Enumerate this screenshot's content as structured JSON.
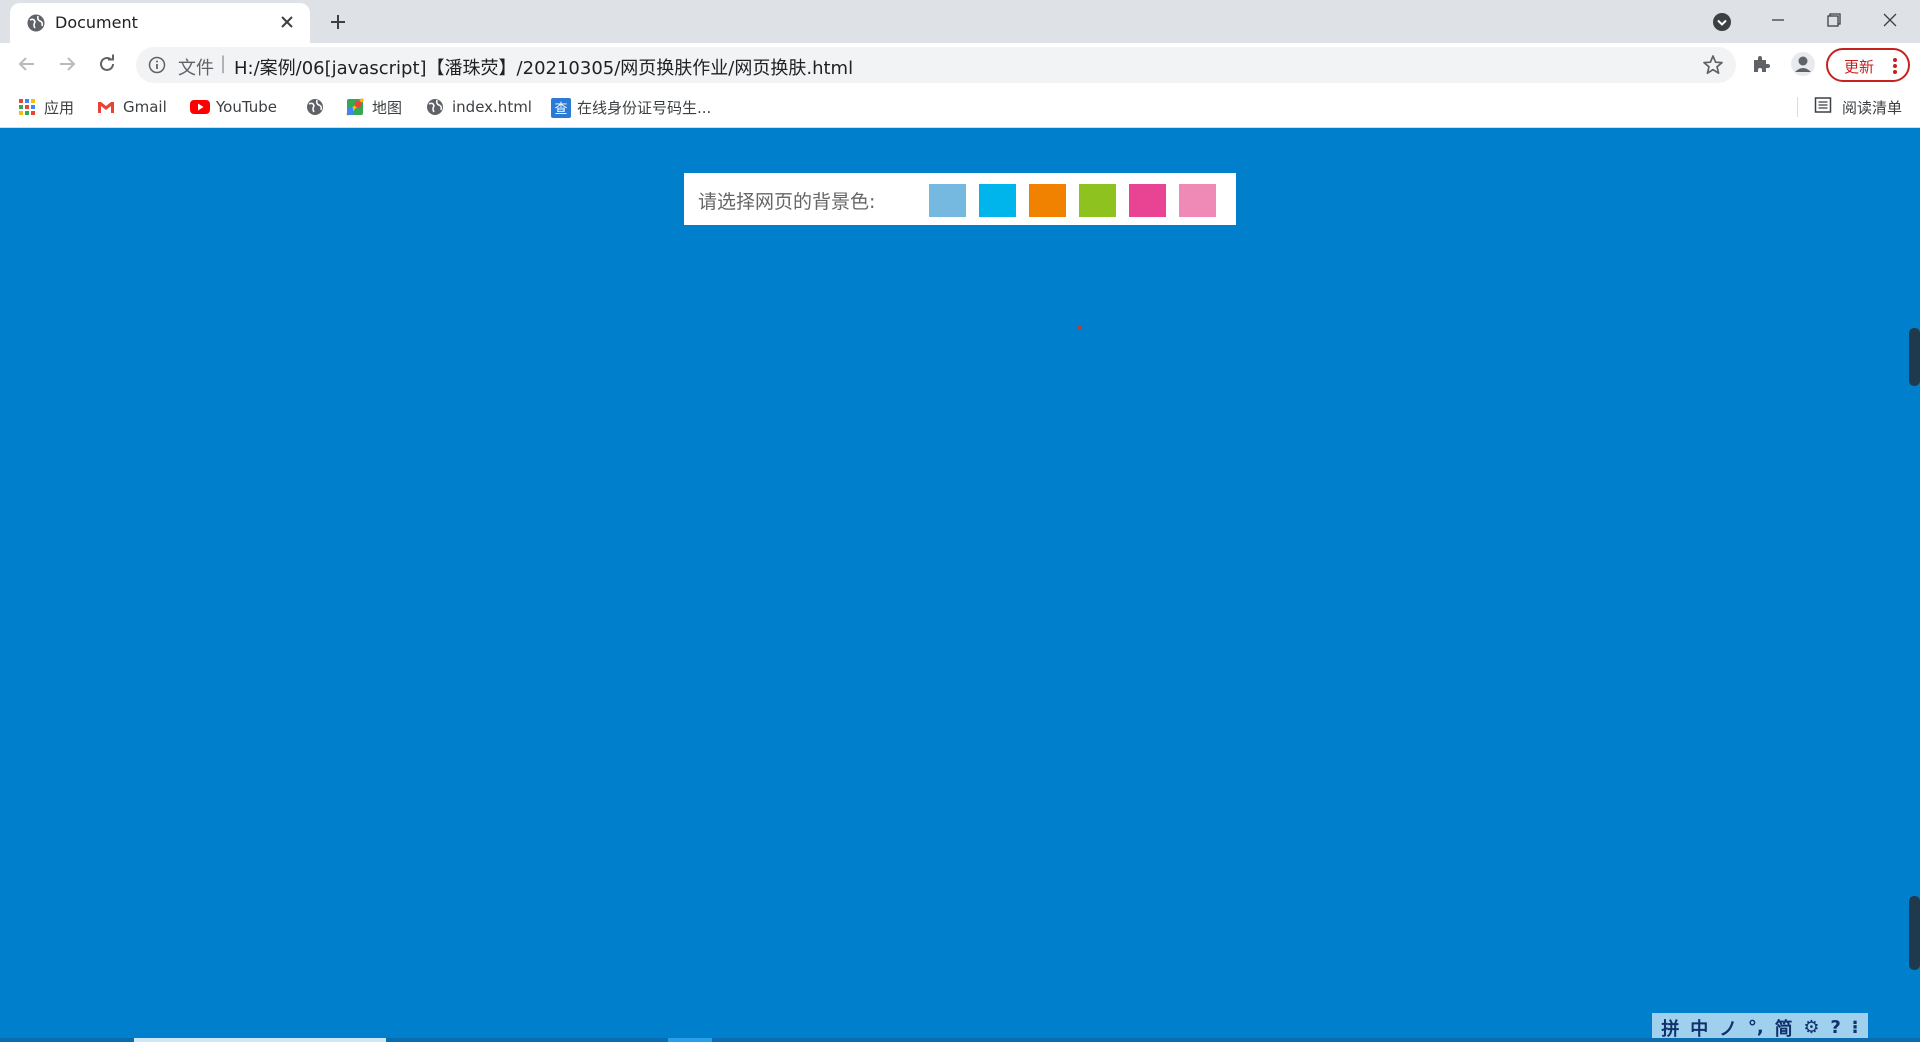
{
  "browser": {
    "tab": {
      "title": "Document",
      "icon": "globe-icon"
    },
    "window_controls": [
      "minimize-icon",
      "restore-icon",
      "close-icon"
    ],
    "omnibox": {
      "scheme_label": "文件",
      "separator": "|",
      "url": "H:/案例/06[javascript]【潘珠荧】/20210305/网页换肤作业/网页换肤.html"
    },
    "update_label": "更新",
    "bookmarks": [
      {
        "label": "应用",
        "icon": "apps-grid-icon"
      },
      {
        "label": "Gmail",
        "icon": "gmail-icon"
      },
      {
        "label": "YouTube",
        "icon": "youtube-icon"
      },
      {
        "label": "",
        "icon": "globe-icon"
      },
      {
        "label": "地图",
        "icon": "maps-icon"
      },
      {
        "label": "index.html",
        "icon": "globe-icon"
      },
      {
        "label": "在线身份证号码生...",
        "icon": "cha-icon"
      }
    ],
    "reading_list_label": "阅读清单"
  },
  "page": {
    "background_color": "#0080cc",
    "picker_label": "请选择网页的背景色:",
    "swatches": [
      {
        "name": "light-blue",
        "color": "#75b8e0"
      },
      {
        "name": "cyan",
        "color": "#00b5eb"
      },
      {
        "name": "orange",
        "color": "#f08200"
      },
      {
        "name": "green",
        "color": "#8dc21f"
      },
      {
        "name": "magenta",
        "color": "#e94393"
      },
      {
        "name": "pink",
        "color": "#ef8ab7"
      }
    ]
  },
  "ime_toolbar": [
    "拼",
    "中",
    "ノ",
    "°,",
    "简",
    "⚙",
    "?",
    "⁝"
  ]
}
